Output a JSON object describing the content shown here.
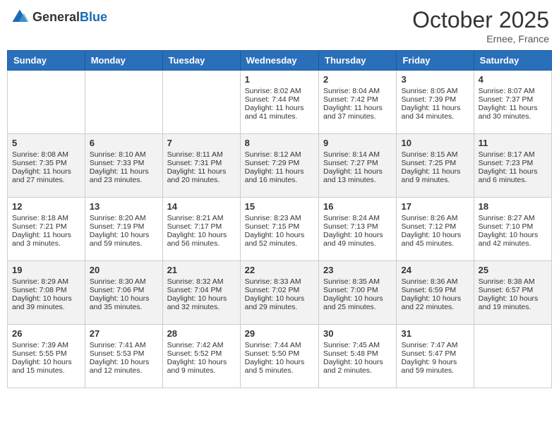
{
  "header": {
    "logo_general": "General",
    "logo_blue": "Blue",
    "month": "October 2025",
    "location": "Ernee, France"
  },
  "weekdays": [
    "Sunday",
    "Monday",
    "Tuesday",
    "Wednesday",
    "Thursday",
    "Friday",
    "Saturday"
  ],
  "weeks": [
    [
      {
        "day": "",
        "info": ""
      },
      {
        "day": "",
        "info": ""
      },
      {
        "day": "",
        "info": ""
      },
      {
        "day": "1",
        "info": "Sunrise: 8:02 AM\nSunset: 7:44 PM\nDaylight: 11 hours\nand 41 minutes."
      },
      {
        "day": "2",
        "info": "Sunrise: 8:04 AM\nSunset: 7:42 PM\nDaylight: 11 hours\nand 37 minutes."
      },
      {
        "day": "3",
        "info": "Sunrise: 8:05 AM\nSunset: 7:39 PM\nDaylight: 11 hours\nand 34 minutes."
      },
      {
        "day": "4",
        "info": "Sunrise: 8:07 AM\nSunset: 7:37 PM\nDaylight: 11 hours\nand 30 minutes."
      }
    ],
    [
      {
        "day": "5",
        "info": "Sunrise: 8:08 AM\nSunset: 7:35 PM\nDaylight: 11 hours\nand 27 minutes."
      },
      {
        "day": "6",
        "info": "Sunrise: 8:10 AM\nSunset: 7:33 PM\nDaylight: 11 hours\nand 23 minutes."
      },
      {
        "day": "7",
        "info": "Sunrise: 8:11 AM\nSunset: 7:31 PM\nDaylight: 11 hours\nand 20 minutes."
      },
      {
        "day": "8",
        "info": "Sunrise: 8:12 AM\nSunset: 7:29 PM\nDaylight: 11 hours\nand 16 minutes."
      },
      {
        "day": "9",
        "info": "Sunrise: 8:14 AM\nSunset: 7:27 PM\nDaylight: 11 hours\nand 13 minutes."
      },
      {
        "day": "10",
        "info": "Sunrise: 8:15 AM\nSunset: 7:25 PM\nDaylight: 11 hours\nand 9 minutes."
      },
      {
        "day": "11",
        "info": "Sunrise: 8:17 AM\nSunset: 7:23 PM\nDaylight: 11 hours\nand 6 minutes."
      }
    ],
    [
      {
        "day": "12",
        "info": "Sunrise: 8:18 AM\nSunset: 7:21 PM\nDaylight: 11 hours\nand 3 minutes."
      },
      {
        "day": "13",
        "info": "Sunrise: 8:20 AM\nSunset: 7:19 PM\nDaylight: 10 hours\nand 59 minutes."
      },
      {
        "day": "14",
        "info": "Sunrise: 8:21 AM\nSunset: 7:17 PM\nDaylight: 10 hours\nand 56 minutes."
      },
      {
        "day": "15",
        "info": "Sunrise: 8:23 AM\nSunset: 7:15 PM\nDaylight: 10 hours\nand 52 minutes."
      },
      {
        "day": "16",
        "info": "Sunrise: 8:24 AM\nSunset: 7:13 PM\nDaylight: 10 hours\nand 49 minutes."
      },
      {
        "day": "17",
        "info": "Sunrise: 8:26 AM\nSunset: 7:12 PM\nDaylight: 10 hours\nand 45 minutes."
      },
      {
        "day": "18",
        "info": "Sunrise: 8:27 AM\nSunset: 7:10 PM\nDaylight: 10 hours\nand 42 minutes."
      }
    ],
    [
      {
        "day": "19",
        "info": "Sunrise: 8:29 AM\nSunset: 7:08 PM\nDaylight: 10 hours\nand 39 minutes."
      },
      {
        "day": "20",
        "info": "Sunrise: 8:30 AM\nSunset: 7:06 PM\nDaylight: 10 hours\nand 35 minutes."
      },
      {
        "day": "21",
        "info": "Sunrise: 8:32 AM\nSunset: 7:04 PM\nDaylight: 10 hours\nand 32 minutes."
      },
      {
        "day": "22",
        "info": "Sunrise: 8:33 AM\nSunset: 7:02 PM\nDaylight: 10 hours\nand 29 minutes."
      },
      {
        "day": "23",
        "info": "Sunrise: 8:35 AM\nSunset: 7:00 PM\nDaylight: 10 hours\nand 25 minutes."
      },
      {
        "day": "24",
        "info": "Sunrise: 8:36 AM\nSunset: 6:59 PM\nDaylight: 10 hours\nand 22 minutes."
      },
      {
        "day": "25",
        "info": "Sunrise: 8:38 AM\nSunset: 6:57 PM\nDaylight: 10 hours\nand 19 minutes."
      }
    ],
    [
      {
        "day": "26",
        "info": "Sunrise: 7:39 AM\nSunset: 5:55 PM\nDaylight: 10 hours\nand 15 minutes."
      },
      {
        "day": "27",
        "info": "Sunrise: 7:41 AM\nSunset: 5:53 PM\nDaylight: 10 hours\nand 12 minutes."
      },
      {
        "day": "28",
        "info": "Sunrise: 7:42 AM\nSunset: 5:52 PM\nDaylight: 10 hours\nand 9 minutes."
      },
      {
        "day": "29",
        "info": "Sunrise: 7:44 AM\nSunset: 5:50 PM\nDaylight: 10 hours\nand 5 minutes."
      },
      {
        "day": "30",
        "info": "Sunrise: 7:45 AM\nSunset: 5:48 PM\nDaylight: 10 hours\nand 2 minutes."
      },
      {
        "day": "31",
        "info": "Sunrise: 7:47 AM\nSunset: 5:47 PM\nDaylight: 9 hours\nand 59 minutes."
      },
      {
        "day": "",
        "info": ""
      }
    ]
  ]
}
